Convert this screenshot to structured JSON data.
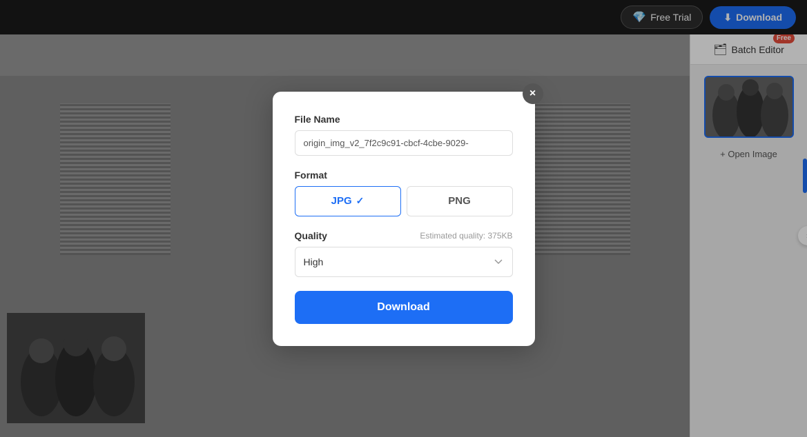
{
  "header": {
    "free_trial_label": "Free Trial",
    "download_label": "Download"
  },
  "sidebar": {
    "batch_editor_label": "Batch Editor",
    "free_badge": "Free",
    "open_image_label": "+ Open Image"
  },
  "modal": {
    "file_name_label": "File Name",
    "file_name_value": "origin_img_v2_7f2c9c91-cbcf-4cbe-9029-",
    "format_label": "Format",
    "jpg_label": "JPG",
    "png_label": "PNG",
    "quality_label": "Quality",
    "estimated_quality": "Estimated quality: 375KB",
    "quality_value": "High",
    "download_label": "Download",
    "close_label": "×"
  }
}
